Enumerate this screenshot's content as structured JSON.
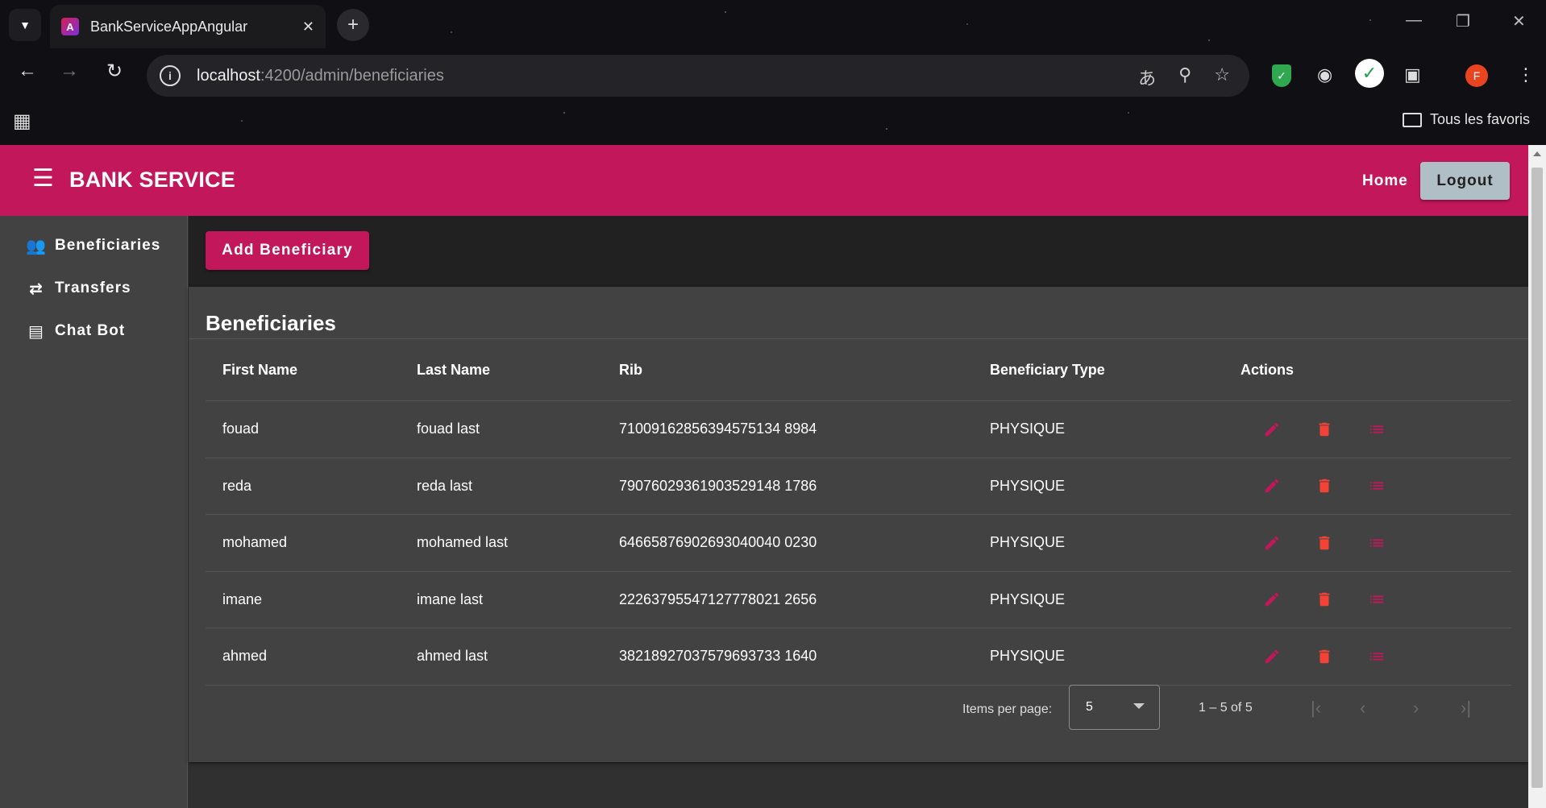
{
  "browser": {
    "tab_title": "BankServiceAppAngular",
    "url_host": "localhost",
    "url_path": ":4200/admin/beneficiaries",
    "bookmarks_folder": "Tous les favoris",
    "profile_initial": "F"
  },
  "app": {
    "brand": "BANK SERVICE",
    "home_label": "Home",
    "logout_label": "Logout",
    "accent_color": "#c2185b"
  },
  "sidebar": {
    "items": [
      {
        "label": "Beneficiaries",
        "icon": "people-icon"
      },
      {
        "label": "Transfers",
        "icon": "swap-arrows-icon"
      },
      {
        "label": "Chat Bot",
        "icon": "chat-icon"
      }
    ]
  },
  "main": {
    "add_button": "Add Beneficiary",
    "card_title": "Beneficiaries",
    "columns": [
      "First Name",
      "Last Name",
      "Rib",
      "Beneficiary Type",
      "Actions"
    ],
    "rows": [
      {
        "first": "fouad",
        "last": "fouad last",
        "rib": "71009162856394575134 8984",
        "type": "PHYSIQUE"
      },
      {
        "first": "reda",
        "last": "reda last",
        "rib": "79076029361903529148 1786",
        "type": "PHYSIQUE"
      },
      {
        "first": "mohamed",
        "last": "mohamed last",
        "rib": "64665876902693040040 0230",
        "type": "PHYSIQUE"
      },
      {
        "first": "imane",
        "last": "imane last",
        "rib": "22263795547127778021 2656",
        "type": "PHYSIQUE"
      },
      {
        "first": "ahmed",
        "last": "ahmed last",
        "rib": "38218927037579693733 1640",
        "type": "PHYSIQUE"
      }
    ],
    "paginator": {
      "items_per_page_label": "Items per page:",
      "page_size": "5",
      "range_label": "1 – 5 of 5"
    }
  }
}
